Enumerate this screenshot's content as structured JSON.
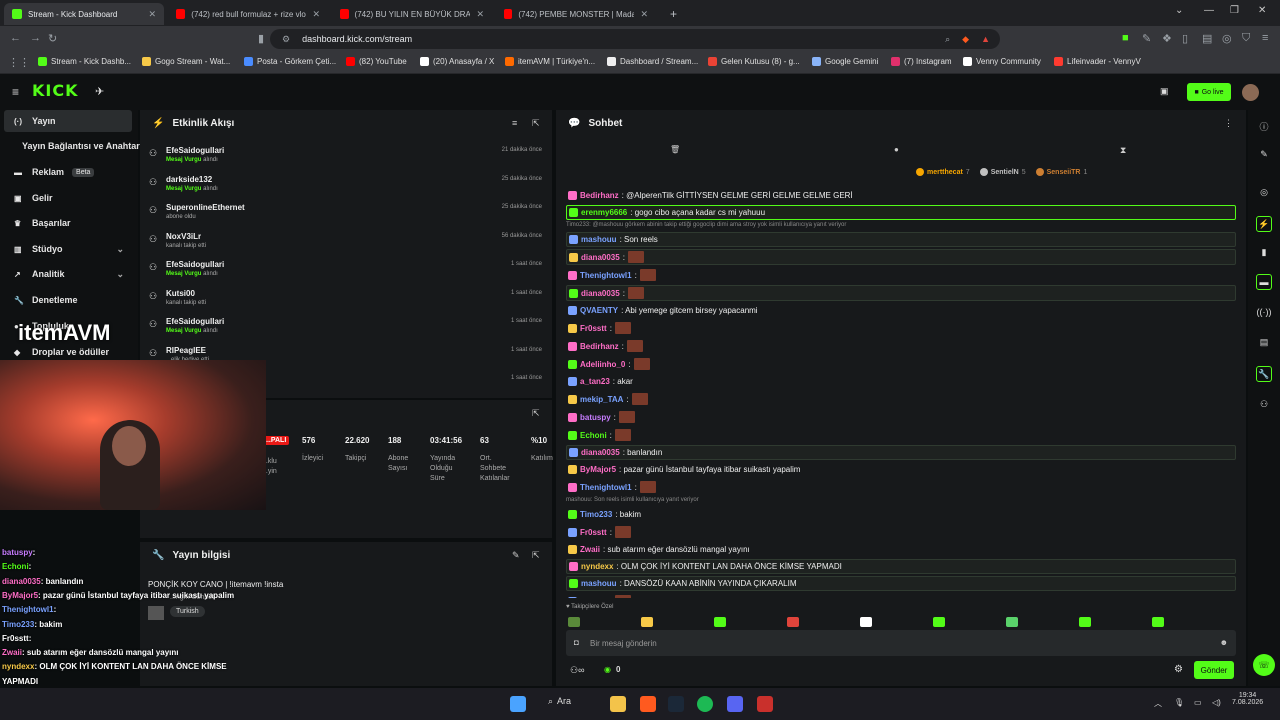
{
  "browser": {
    "tabs": [
      {
        "title": "Stream - Kick Dashboard",
        "color": "#53fc18"
      },
      {
        "title": "(742) red bull formulaz + rize vlog -",
        "color": "#ff0000"
      },
      {
        "title": "(742) BU YILIN EN BÜYÜK DRAMASI",
        "color": "#ff0000"
      },
      {
        "title": "(742) PEMBE MONSTER | Madara Olu",
        "color": "#ff0000"
      }
    ],
    "url": "dashboard.kick.com/stream",
    "bookmarks": [
      "Stream - Kick Dashb...",
      "Gogo Stream - Wat...",
      "Posta - Görkem Çeti...",
      "(82) YouTube",
      "(20) Anasayfa / X",
      "itemAVM | Türkiye'n...",
      "Dashboard / Stream...",
      "Gelen Kutusu (8) - g...",
      "Google Gemini",
      "(7) Instagram",
      "Venny Community",
      "Lifeinvader - VennyV"
    ]
  },
  "kick": {
    "logo": "KICK",
    "go_live": "Go live"
  },
  "sidebar": {
    "items": [
      {
        "label": "Yayın",
        "icon": "(·)"
      },
      {
        "label": "Yayın Bağlantısı ve Anahtarı",
        "icon": ""
      },
      {
        "label": "Reklam",
        "icon": "▬",
        "badge": "Beta"
      },
      {
        "label": "Gelir",
        "icon": "▣"
      },
      {
        "label": "Başarılar",
        "icon": "♛"
      },
      {
        "label": "Stüdyo",
        "icon": "▥",
        "chevron": "⌄"
      },
      {
        "label": "Analitik",
        "icon": "↗",
        "chevron": "⌄"
      },
      {
        "label": "Denetleme",
        "icon": "🔧"
      },
      {
        "label": "Topluluk",
        "icon": "●"
      },
      {
        "label": "Droplar ve ödüller",
        "icon": "◆"
      }
    ]
  },
  "activity": {
    "title": "Etkinlik Akışı",
    "items": [
      {
        "name": "EfeSaidogullari",
        "sub_hl": "Mesaj Vurgu",
        "sub": " alındı",
        "time": "21 dakika önce"
      },
      {
        "name": "darkside132",
        "sub_hl": "Mesaj Vurgu",
        "sub": " alındı",
        "time": "25 dakika önce"
      },
      {
        "name": "SuperonlineEthernet",
        "sub_hl": "",
        "sub": "abone oldu",
        "time": "25 dakika önce"
      },
      {
        "name": "NoxV3iLr",
        "sub_hl": "",
        "sub": "kanalı takip etti",
        "time": "56 dakika önce"
      },
      {
        "name": "EfeSaidogullari",
        "sub_hl": "Mesaj Vurgu",
        "sub": " alındı",
        "time": "1 saat önce"
      },
      {
        "name": "Kutsi00",
        "sub_hl": "",
        "sub": "kanalı takip etti",
        "time": "1 saat önce"
      },
      {
        "name": "EfeSaidogullari",
        "sub_hl": "Mesaj Vurgu",
        "sub": " alındı",
        "time": "1 saat önce"
      },
      {
        "name": "RIPeaglEE",
        "sub_hl": "",
        "sub": "...elik hediye etti.",
        "time": "1 saat önce"
      },
      {
        "name": "...ul",
        "sub_hl": "",
        "sub": "",
        "time": "1 saat önce"
      }
    ]
  },
  "stats": {
    "live_badge": "...PALI",
    "items": [
      {
        "value": "",
        "label": "...klu\n...yin"
      },
      {
        "value": "576",
        "label": "İzleyici"
      },
      {
        "value": "22.620",
        "label": "Takipçi"
      },
      {
        "value": "188",
        "label": "Abone\nSayısı"
      },
      {
        "value": "03:41:56",
        "label": "Yayında\nOlduğu\nSüre"
      },
      {
        "value": "63",
        "label": "Ort.\nSohbete\nKatılanlar"
      },
      {
        "value": "%10",
        "label": "Katılım"
      }
    ]
  },
  "stream_info": {
    "title": "Yayın bilgisi",
    "stream_title": "PONÇİK KOY CANO | !itemavm !insta",
    "category": "...ngırı Sohbet",
    "language": "Turkish"
  },
  "overlay": {
    "brand": "itemAVM",
    "lines": [
      {
        "user": "batuspy",
        "color": "#c77dff",
        "text": ":"
      },
      {
        "user": "Echoni",
        "color": "#53fc18",
        "text": ":"
      },
      {
        "user": "diana0035",
        "color": "#ff6ec7",
        "text": ": banlandın"
      },
      {
        "user": "ByMajor5",
        "color": "#ff6ec7",
        "text": ": pazar günü İstanbul tayfaya itibar suikastı yapalim"
      },
      {
        "user": "Thenightowl1",
        "color": "#7aa2ff",
        "text": ":"
      },
      {
        "user": "Timo233",
        "color": "#7aa2ff",
        "text": ": bakim"
      },
      {
        "user": "Fr0sstt",
        "color": "#ffffff",
        "text": ":"
      },
      {
        "user": "Zwaii",
        "color": "#ff6ec7",
        "text": ": sub atarım eğer dansözlü mangal yayını"
      },
      {
        "user": "nyndexx",
        "color": "#f7c948",
        "text": ": OLM ÇOK İYİ KONTENT LAN DAHA ÖNCE KİMSE"
      },
      {
        "user": "",
        "color": "#ffffff",
        "text": "YAPMADI"
      },
      {
        "user": "mashouu",
        "color": "#7aa2ff",
        "text": ": DANSÖZÜ KAAN ABİNİN YAYINDA ÇIKARALIM"
      },
      {
        "user": "Fr0sstt",
        "color": "#ffffff",
        "text": ":"
      }
    ]
  },
  "chat": {
    "title": "Sohbet",
    "top_users": [
      {
        "name": "mertthecat",
        "count": "7"
      },
      {
        "name": "SentielN",
        "count": "5"
      },
      {
        "name": "SenseiiTR",
        "count": "1"
      }
    ],
    "messages": [
      {
        "user": "Bedirhanz",
        "color": "#ff6ec7",
        "text": ": @AlperenTilk GİTTİYSEN GELME GERİ GELME GELME GERİ",
        "style": ""
      },
      {
        "user": "erenmy6666",
        "color": "#53fc18",
        "text": ": gogo cibo açana kadar cs mi yahuuu",
        "style": "hl"
      },
      {
        "user": "mashouu",
        "color": "#7aa2ff",
        "text": ": Son reels",
        "style": "hl2",
        "reply": "Timo233: @mashouu görkem abinin takip ettiği gogoclip dimi ama stroy yok isimli kullanıcıya yanıt veriyor"
      },
      {
        "user": "diana0035",
        "color": "#ff6ec7",
        "text": ":",
        "style": "hl2",
        "emote": true
      },
      {
        "user": "Thenightowl1",
        "color": "#7aa2ff",
        "text": ":",
        "style": "",
        "emote": true
      },
      {
        "user": "diana0035",
        "color": "#ff6ec7",
        "text": ":",
        "style": "hl2",
        "emote": true
      },
      {
        "user": "QVAENTY",
        "color": "#7aa2ff",
        "text": ": Abi yemege gitcem birsey yapacanmi",
        "style": ""
      },
      {
        "user": "Fr0sstt",
        "color": "#ff6ec7",
        "text": ":",
        "style": "",
        "emote": true
      },
      {
        "user": "Bedirhanz",
        "color": "#ff6ec7",
        "text": ":",
        "style": "",
        "emote": true
      },
      {
        "user": "Adeliinho_0",
        "color": "#ff6ec7",
        "text": ":",
        "style": "",
        "emote": true
      },
      {
        "user": "a_tan23",
        "color": "#ff6ec7",
        "text": ": akar",
        "style": ""
      },
      {
        "user": "mekip_TAA",
        "color": "#7aa2ff",
        "text": ":",
        "style": "",
        "emote": true
      },
      {
        "user": "batuspy",
        "color": "#c77dff",
        "text": ":",
        "style": "",
        "emote": true
      },
      {
        "user": "Echoni",
        "color": "#53fc18",
        "text": ":",
        "style": "",
        "emote": true
      },
      {
        "user": "diana0035",
        "color": "#ff6ec7",
        "text": ": banlandın",
        "style": "hl2"
      },
      {
        "user": "ByMajor5",
        "color": "#ff6ec7",
        "text": ": pazar günü İstanbul tayfaya itibar suikastı yapalim",
        "style": ""
      },
      {
        "user": "Thenightowl1",
        "color": "#7aa2ff",
        "text": ":",
        "style": "",
        "emote": true
      },
      {
        "user": "Timo233",
        "color": "#7aa2ff",
        "text": ": bakim",
        "style": "",
        "reply": "mashouu: Son reels isimli kullanıcıya yanıt veriyor"
      },
      {
        "user": "Fr0sstt",
        "color": "#ff6ec7",
        "text": ":",
        "style": "",
        "emote": true
      },
      {
        "user": "Zwaii",
        "color": "#ff6ec7",
        "text": ": sub atarım eğer dansözlü mangal yayını",
        "style": ""
      },
      {
        "user": "nyndexx",
        "color": "#f7c948",
        "text": ": OLM ÇOK İYİ KONTENT LAN DAHA ÖNCE KİMSE YAPMADI",
        "style": "hl2"
      },
      {
        "user": "mashouu",
        "color": "#7aa2ff",
        "text": ": DANSÖZÜ KAAN ABİNİN YAYINDA ÇIKARALIM",
        "style": "hl2"
      },
      {
        "user": "Fr0sstt",
        "color": "#ff6ec7",
        "text": ":",
        "style": "",
        "emote": true
      }
    ],
    "followers_only": "Takipçilere Özel",
    "placeholder": "Bir mesaj gönderin",
    "send": "Gönder",
    "points": "0"
  },
  "taskbar": {
    "search": "Ara",
    "time": "19:34",
    "date": "7.08.2026"
  },
  "colors": {
    "accent": "#53fc18",
    "panel": "#17191b",
    "bg": "#0b0e0f"
  }
}
